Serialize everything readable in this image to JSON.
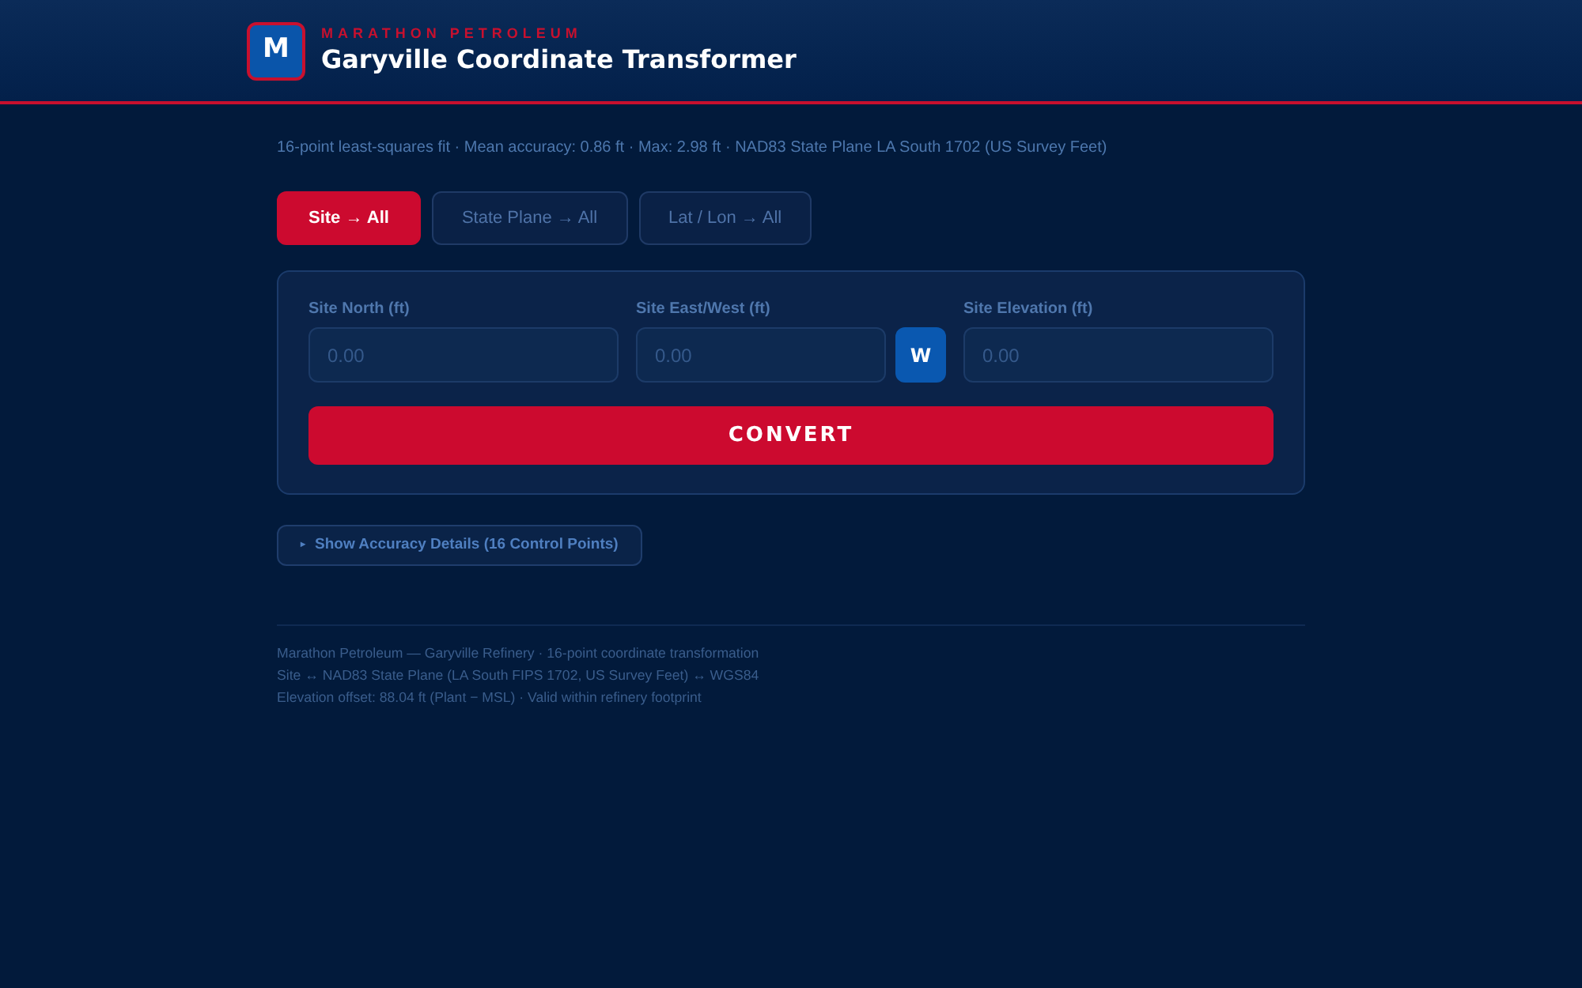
{
  "header": {
    "logo": "M",
    "company": "MARATHON PETROLEUM",
    "title": "Garyville Coordinate Transformer"
  },
  "summary": "16-point least-squares fit · Mean accuracy: 0.86 ft · Max: 2.98 ft · NAD83 State Plane LA South 1702 (US Survey Feet)",
  "tabs": [
    {
      "label": "Site → All",
      "selected": true
    },
    {
      "label": "State Plane → All",
      "selected": false
    },
    {
      "label": "Lat / Lon → All",
      "selected": false
    }
  ],
  "form": {
    "fields": [
      {
        "kind": "input",
        "label": "Site North (ft)",
        "placeholder": "0.00"
      },
      {
        "kind": "input_toggle",
        "label": "Site East/West (ft)",
        "placeholder": "0.00",
        "toggle": "W"
      },
      {
        "kind": "input",
        "label": "Site Elevation (ft)",
        "placeholder": "0.00"
      }
    ],
    "submit": "CONVERT"
  },
  "details_toggle": {
    "icon": "▸",
    "label": "Show Accuracy Details (16 Control Points)"
  },
  "footer": [
    "Marathon Petroleum — Garyville Refinery · 16-point coordinate transformation",
    "Site ↔ NAD83 State Plane (LA South FIPS 1702, US Survey Feet) ↔ WGS84",
    "Elevation offset: 88.04 ft (Plant − MSL) · Valid within refinery footprint"
  ]
}
